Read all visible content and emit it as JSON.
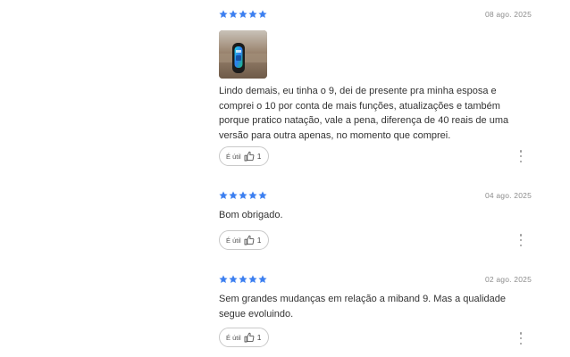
{
  "colors": {
    "star": "#3c7ff0",
    "text": "#333333",
    "date": "#8c8c8c"
  },
  "reviews": [
    {
      "rating": 5,
      "date": "08 ago. 2025",
      "has_photo": true,
      "text": "Lindo demais, eu tinha o 9, dei de presente pra minha esposa e comprei o 10 por conta de mais funções, atualizações e também porque pratico natação, vale a pena, diferença de 40 reais de uma versão para outra apenas, no momento que comprei.",
      "helpful_label": "É útil",
      "helpful_count": "1",
      "icons": {
        "helpful": "thumbs-up-icon",
        "more": "more-vertical-icon"
      }
    },
    {
      "rating": 5,
      "date": "04 ago. 2025",
      "has_photo": false,
      "text": "Bom obrigado.",
      "helpful_label": "É útil",
      "helpful_count": "1",
      "icons": {
        "helpful": "thumbs-up-icon",
        "more": "more-vertical-icon"
      }
    },
    {
      "rating": 5,
      "date": "02 ago. 2025",
      "has_photo": false,
      "text": "Sem grandes mudanças em relação a miband 9. Mas a qualidade segue evoluindo.",
      "helpful_label": "É útil",
      "helpful_count": "1",
      "icons": {
        "helpful": "thumbs-up-icon",
        "more": "more-vertical-icon"
      }
    }
  ]
}
